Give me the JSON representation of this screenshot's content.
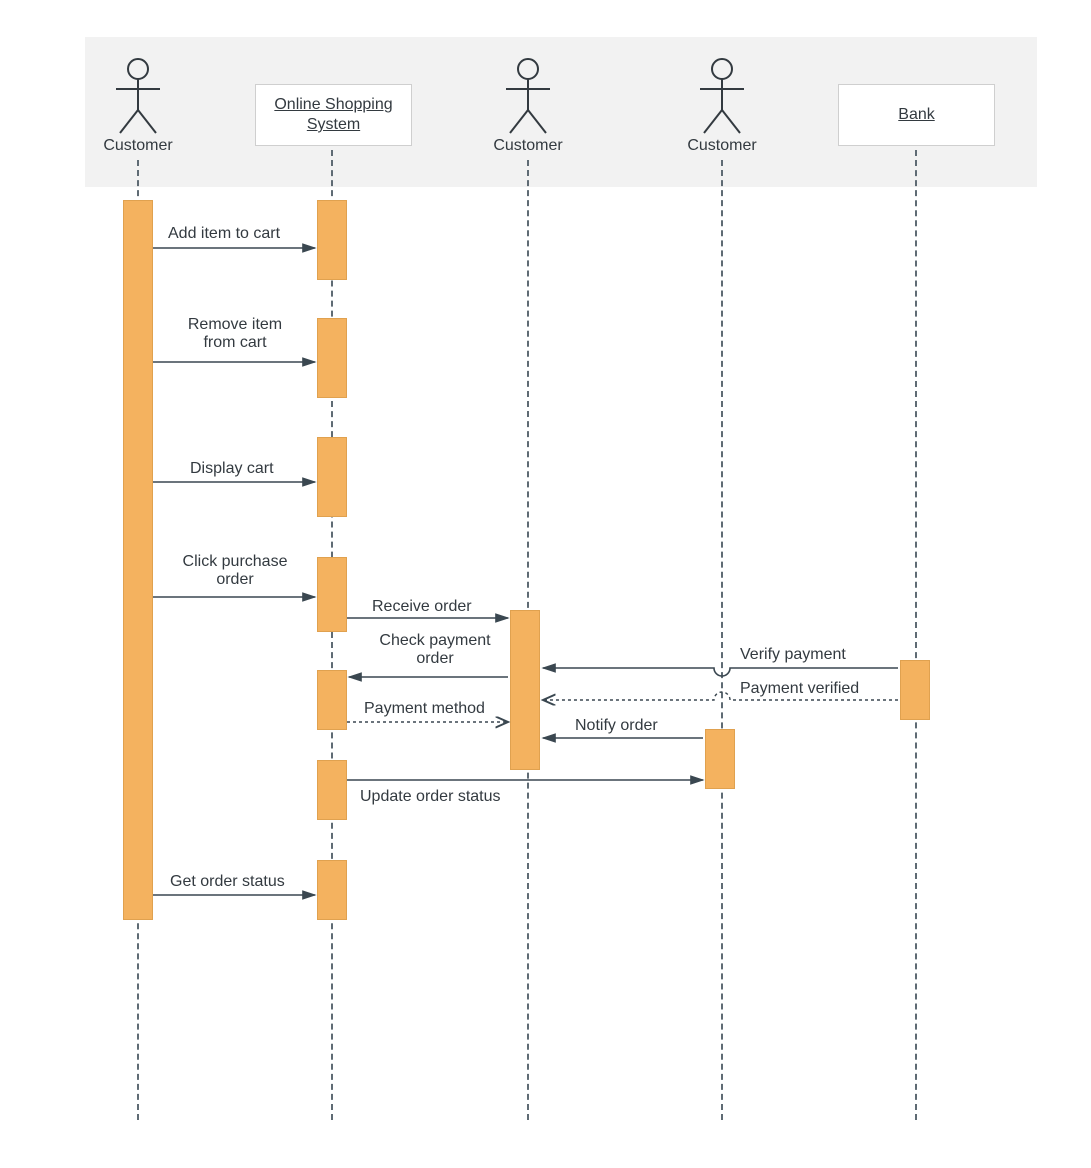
{
  "colors": {
    "accent": "#f4b25f",
    "line": "#3a4750"
  },
  "participants": {
    "p1": {
      "label": "Customer"
    },
    "p2": {
      "label": "Online Shopping System"
    },
    "p3": {
      "label": "Customer"
    },
    "p4": {
      "label": "Customer"
    },
    "p5": {
      "label": "Bank"
    }
  },
  "messages": {
    "m1": "Add item to cart",
    "m2": "Remove item from cart",
    "m3": "Display cart",
    "m4": "Click purchase order",
    "m5": "Receive order",
    "m6": "Check payment order",
    "m7": "Payment method",
    "m8": "Verify payment",
    "m9": "Payment verified",
    "m10": "Notify order",
    "m11": "Update order status",
    "m12": "Get order status"
  }
}
